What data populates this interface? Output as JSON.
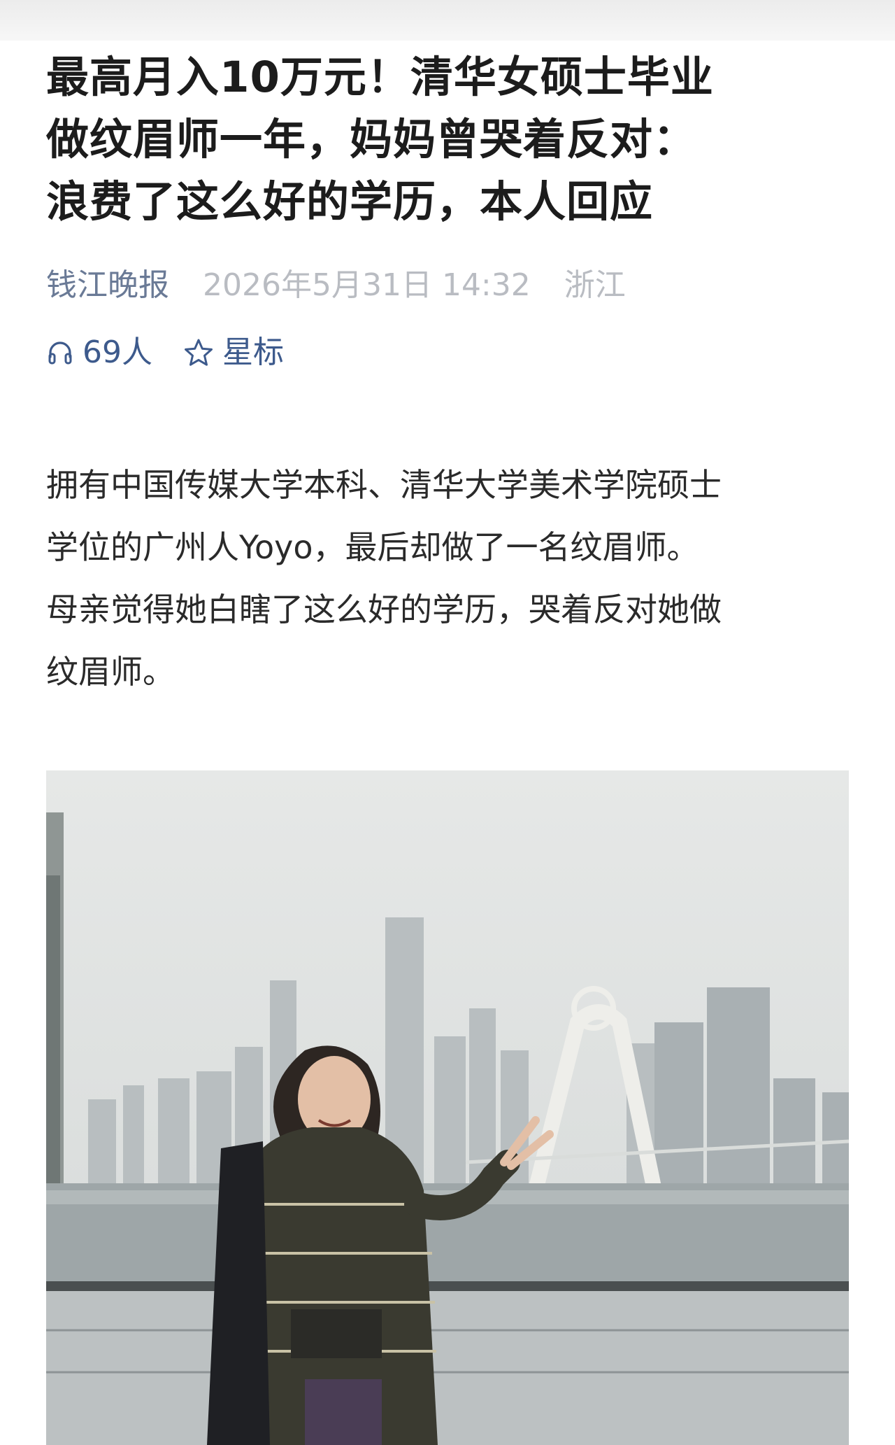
{
  "article": {
    "title_lines": [
      "最高月入10万元！清华女硕士毕业",
      "做纹眉师一年，妈妈曾哭着反对：",
      "浪费了这么好的学历，本人回应"
    ],
    "source": "钱江晚报",
    "date": "2026年5月31日 14:32",
    "location": "浙江",
    "listen_count": "69人",
    "star_label": "星标",
    "lead_lines": [
      "拥有中国传媒大学本科、清华大学美术学院硕士",
      "学位的广州人Yoyo，最后却做了一名纹眉师。",
      "母亲觉得她白瞎了这么好的学历，哭着反对她做",
      "纹眉师。"
    ]
  },
  "icons": {
    "listen": "headphones-icon",
    "star": "star-outline-icon"
  },
  "colors": {
    "title": "#1c1c1c",
    "source": "#6a7a96",
    "meta": "#b9bcc2",
    "accent": "#3d5a8c",
    "body": "#2a2a2a"
  }
}
